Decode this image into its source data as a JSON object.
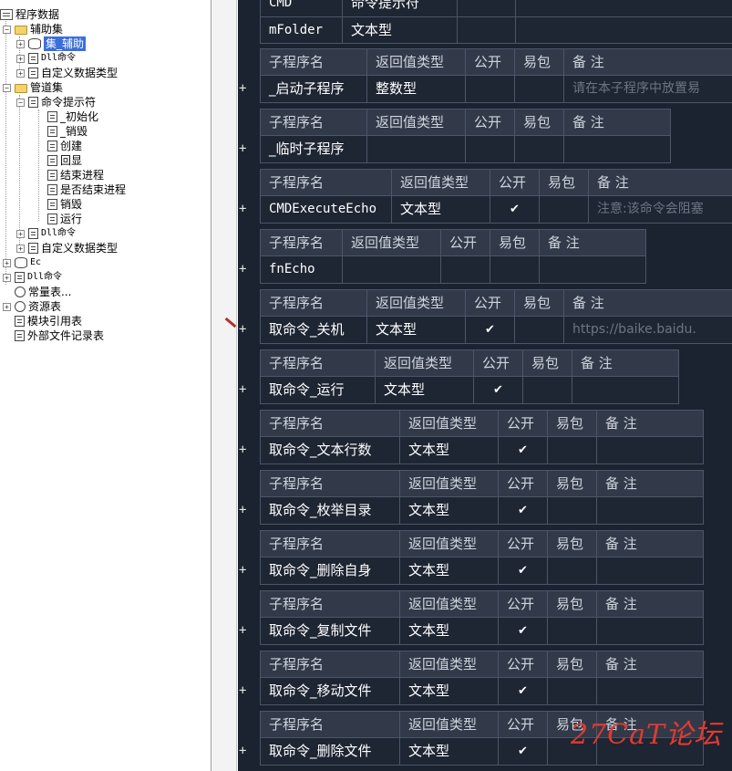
{
  "tree": {
    "root": "程序数据",
    "items": [
      {
        "label": "辅助集",
        "icon": "folder-icon"
      },
      {
        "label": "集_辅助",
        "icon": "module-icon",
        "selected": true
      },
      {
        "label": "Dll命令",
        "icon": "dll-icon"
      },
      {
        "label": "自定义数据类型",
        "icon": "datatype-icon"
      },
      {
        "label": "管道集",
        "icon": "folder-icon"
      },
      {
        "label": "命令提示符",
        "icon": "class-icon"
      },
      {
        "label": "_初始化",
        "icon": "method-icon"
      },
      {
        "label": "_销毁",
        "icon": "method-icon"
      },
      {
        "label": "创建",
        "icon": "method-icon"
      },
      {
        "label": "回显",
        "icon": "method-icon"
      },
      {
        "label": "结束进程",
        "icon": "method-icon"
      },
      {
        "label": "是否结束进程",
        "icon": "method-icon"
      },
      {
        "label": "销毁",
        "icon": "method-icon"
      },
      {
        "label": "运行",
        "icon": "method-icon"
      },
      {
        "label": "Dll命令",
        "icon": "dll-icon"
      },
      {
        "label": "自定义数据类型",
        "icon": "datatype-icon"
      },
      {
        "label": "Ec",
        "icon": "module-icon"
      },
      {
        "label": "Dll命令",
        "icon": "dll-icon"
      },
      {
        "label": "常量表...",
        "icon": "constant-icon"
      },
      {
        "label": "资源表",
        "icon": "resource-icon"
      },
      {
        "label": "模块引用表",
        "icon": "module-ref-icon"
      },
      {
        "label": "外部文件记录表",
        "icon": "file-record-icon"
      }
    ]
  },
  "editor": {
    "top_rows": [
      {
        "name": "CMD",
        "type": "命令提示符"
      },
      {
        "name": "mFolder",
        "type": "文本型"
      }
    ],
    "headers": {
      "name": "子程序名",
      "return_type": "返回值类型",
      "public": "公开",
      "easy_pack": "易包",
      "note": "备 注"
    },
    "subs": [
      {
        "name": "_启动子程序",
        "type": "整数型",
        "public": "",
        "note": "请在本子程序中放置易"
      },
      {
        "name": "_临时子程序",
        "type": "",
        "public": "",
        "note": ""
      },
      {
        "name": "CMDExecuteEcho",
        "type": "文本型",
        "public": "✔",
        "note": "注意:该命令会阻塞"
      },
      {
        "name": "fnEcho",
        "type": "",
        "public": "",
        "note": ""
      },
      {
        "name": "取命令_关机",
        "type": "文本型",
        "public": "✔",
        "note": "https://baike.baidu."
      },
      {
        "name": "取命令_运行",
        "type": "文本型",
        "public": "✔",
        "note": ""
      },
      {
        "name": "取命令_文本行数",
        "type": "文本型",
        "public": "✔",
        "note": ""
      },
      {
        "name": "取命令_枚举目录",
        "type": "文本型",
        "public": "✔",
        "note": ""
      },
      {
        "name": "取命令_删除自身",
        "type": "文本型",
        "public": "✔",
        "note": ""
      },
      {
        "name": "取命令_复制文件",
        "type": "文本型",
        "public": "✔",
        "note": ""
      },
      {
        "name": "取命令_移动文件",
        "type": "文本型",
        "public": "✔",
        "note": ""
      },
      {
        "name": "取命令_删除文件",
        "type": "文本型",
        "public": "✔",
        "note": ""
      }
    ],
    "expand_symbol": "+"
  },
  "watermark": "27CaT论坛",
  "colors": {
    "editor_bg": "#1b2230",
    "header_bg": "#323a4a",
    "selection": "#3a6fd8",
    "watermark": "#e23a2f"
  }
}
